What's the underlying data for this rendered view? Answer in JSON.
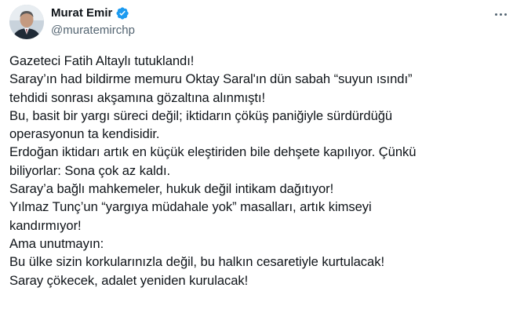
{
  "author": {
    "display_name": "Murat Emir",
    "handle": "@muratemirchp",
    "verified": true,
    "verified_color": "#1d9bf0"
  },
  "more_icon": "more-horizontal-icon",
  "tweet": {
    "lines": [
      "Gazeteci Fatih Altaylı tutuklandı!",
      "Saray’ın had bildirme memuru Oktay Saral'ın dün sabah “suyun ısındı”",
      "tehdidi sonrası akşamına gözaltına alınmıştı!",
      "Bu, basit bir yargı süreci değil; iktidarın çöküş paniğiyle sürdürdüğü",
      "operasyonun ta kendisidir.",
      "Erdoğan iktidarı artık en küçük eleştiriden bile dehşete kapılıyor. Çünkü",
      "biliyorlar: Sona çok az kaldı.",
      "Saray’a bağlı mahkemeler, hukuk değil intikam dağıtıyor!",
      "Yılmaz Tunç’un “yargıya müdahale yok” masalları, artık kimseyi",
      "kandırmıyor!",
      "Ama unutmayın:",
      "Bu ülke sizin korkularınızla değil, bu halkın cesaretiyle kurtulacak!",
      "Saray çökecek, adalet yeniden kurulacak!"
    ]
  }
}
